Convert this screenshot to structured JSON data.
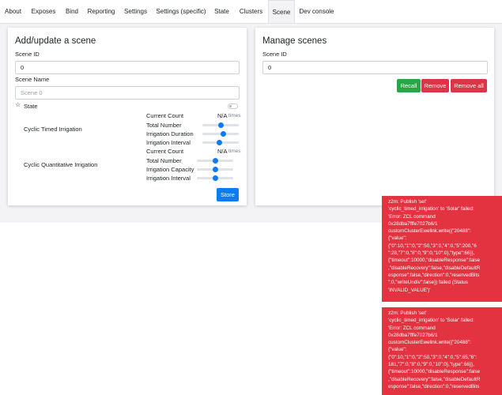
{
  "tabs": [
    "About",
    "Exposes",
    "Bind",
    "Reporting",
    "Settings",
    "Settings (specific)",
    "State",
    "Clusters",
    "Scene",
    "Dev console"
  ],
  "active_tab": "Scene",
  "add_scene": {
    "title": "Add/update a scene",
    "scene_id_label": "Scene ID",
    "scene_id_value": "0",
    "scene_name_label": "Scene Name",
    "scene_name_placeholder": "Scene 0",
    "state_label": "State",
    "cyclic_timed": {
      "title": "Cyclic Timed Irrigation",
      "current_count_label": "Current Count",
      "current_count_value": "N/A",
      "current_count_unit": "times",
      "rows": [
        {
          "label": "Total Number",
          "level": 0.5
        },
        {
          "label": "Irrigation Duration",
          "level": 0.6
        },
        {
          "label": "Irrigation Interval",
          "level": 0.45
        }
      ]
    },
    "cyclic_quantitative": {
      "title": "Cyclic Quantitative Irrigation",
      "current_count_label": "Current Count",
      "current_count_value": "N/A",
      "current_count_unit": "times",
      "rows": [
        {
          "label": "Total Number",
          "level": 0.5
        },
        {
          "label": "Irrigation Capacity",
          "level": 0.5
        },
        {
          "label": "Irrigation Interval",
          "level": 0.5
        }
      ]
    },
    "store_label": "Store"
  },
  "manage_scenes": {
    "title": "Manage scenes",
    "scene_id_label": "Scene ID",
    "scene_id_value": "0",
    "recall_label": "Recall",
    "remove_label": "Remove",
    "remove_all_label": "Remove all"
  },
  "toasts": [
    {
      "lines": [
        "z2m: Publish 'set'",
        "'cyclic_timed_irrigation' to 'Solar' failed:",
        "'Error: ZCL command",
        "0x28dba7fffe7027b6/1",
        "customClusterEwelink.write({\"20488\":",
        "{\"value\":",
        "{\"0\":10,\"1\":0,\"2\":50,\"3\":0,\"4\":0,\"5\":200,\"6",
        "\":28,\"7\":0,\"8\":0,\"9\":0,\"10\":0},\"type\":66}},",
        "{\"timeout\":10000,\"disableResponse\":false",
        ",\"disableRecovery\":false,\"disableDefaultR",
        "esponse\":false,\"direction\":0,\"reservedBits",
        "\":0,\"writeUndiv\":false}) failed (Status",
        "'INVALID_VALUE')'"
      ]
    },
    {
      "lines": [
        "z2m: Publish 'set'",
        "'cyclic_timed_irrigation' to 'Solar' failed:",
        "'Error: ZCL command",
        "0x28dba7fffe7027b6/1",
        "customClusterEwelink.write({\"20488\":",
        "{\"value\":",
        "{\"0\":10,\"1\":0,\"2\":50,\"3\":0,\"4\":0,\"5\":65,\"6\":",
        "181,\"7\":0,\"8\":0,\"9\":0,\"10\":0},\"type\":66}},",
        "{\"timeout\":10000,\"disableResponse\":false",
        ",\"disableRecovery\":false,\"disableDefaultR",
        "esponse\":false,\"direction\":0,\"reservedBits"
      ]
    }
  ]
}
